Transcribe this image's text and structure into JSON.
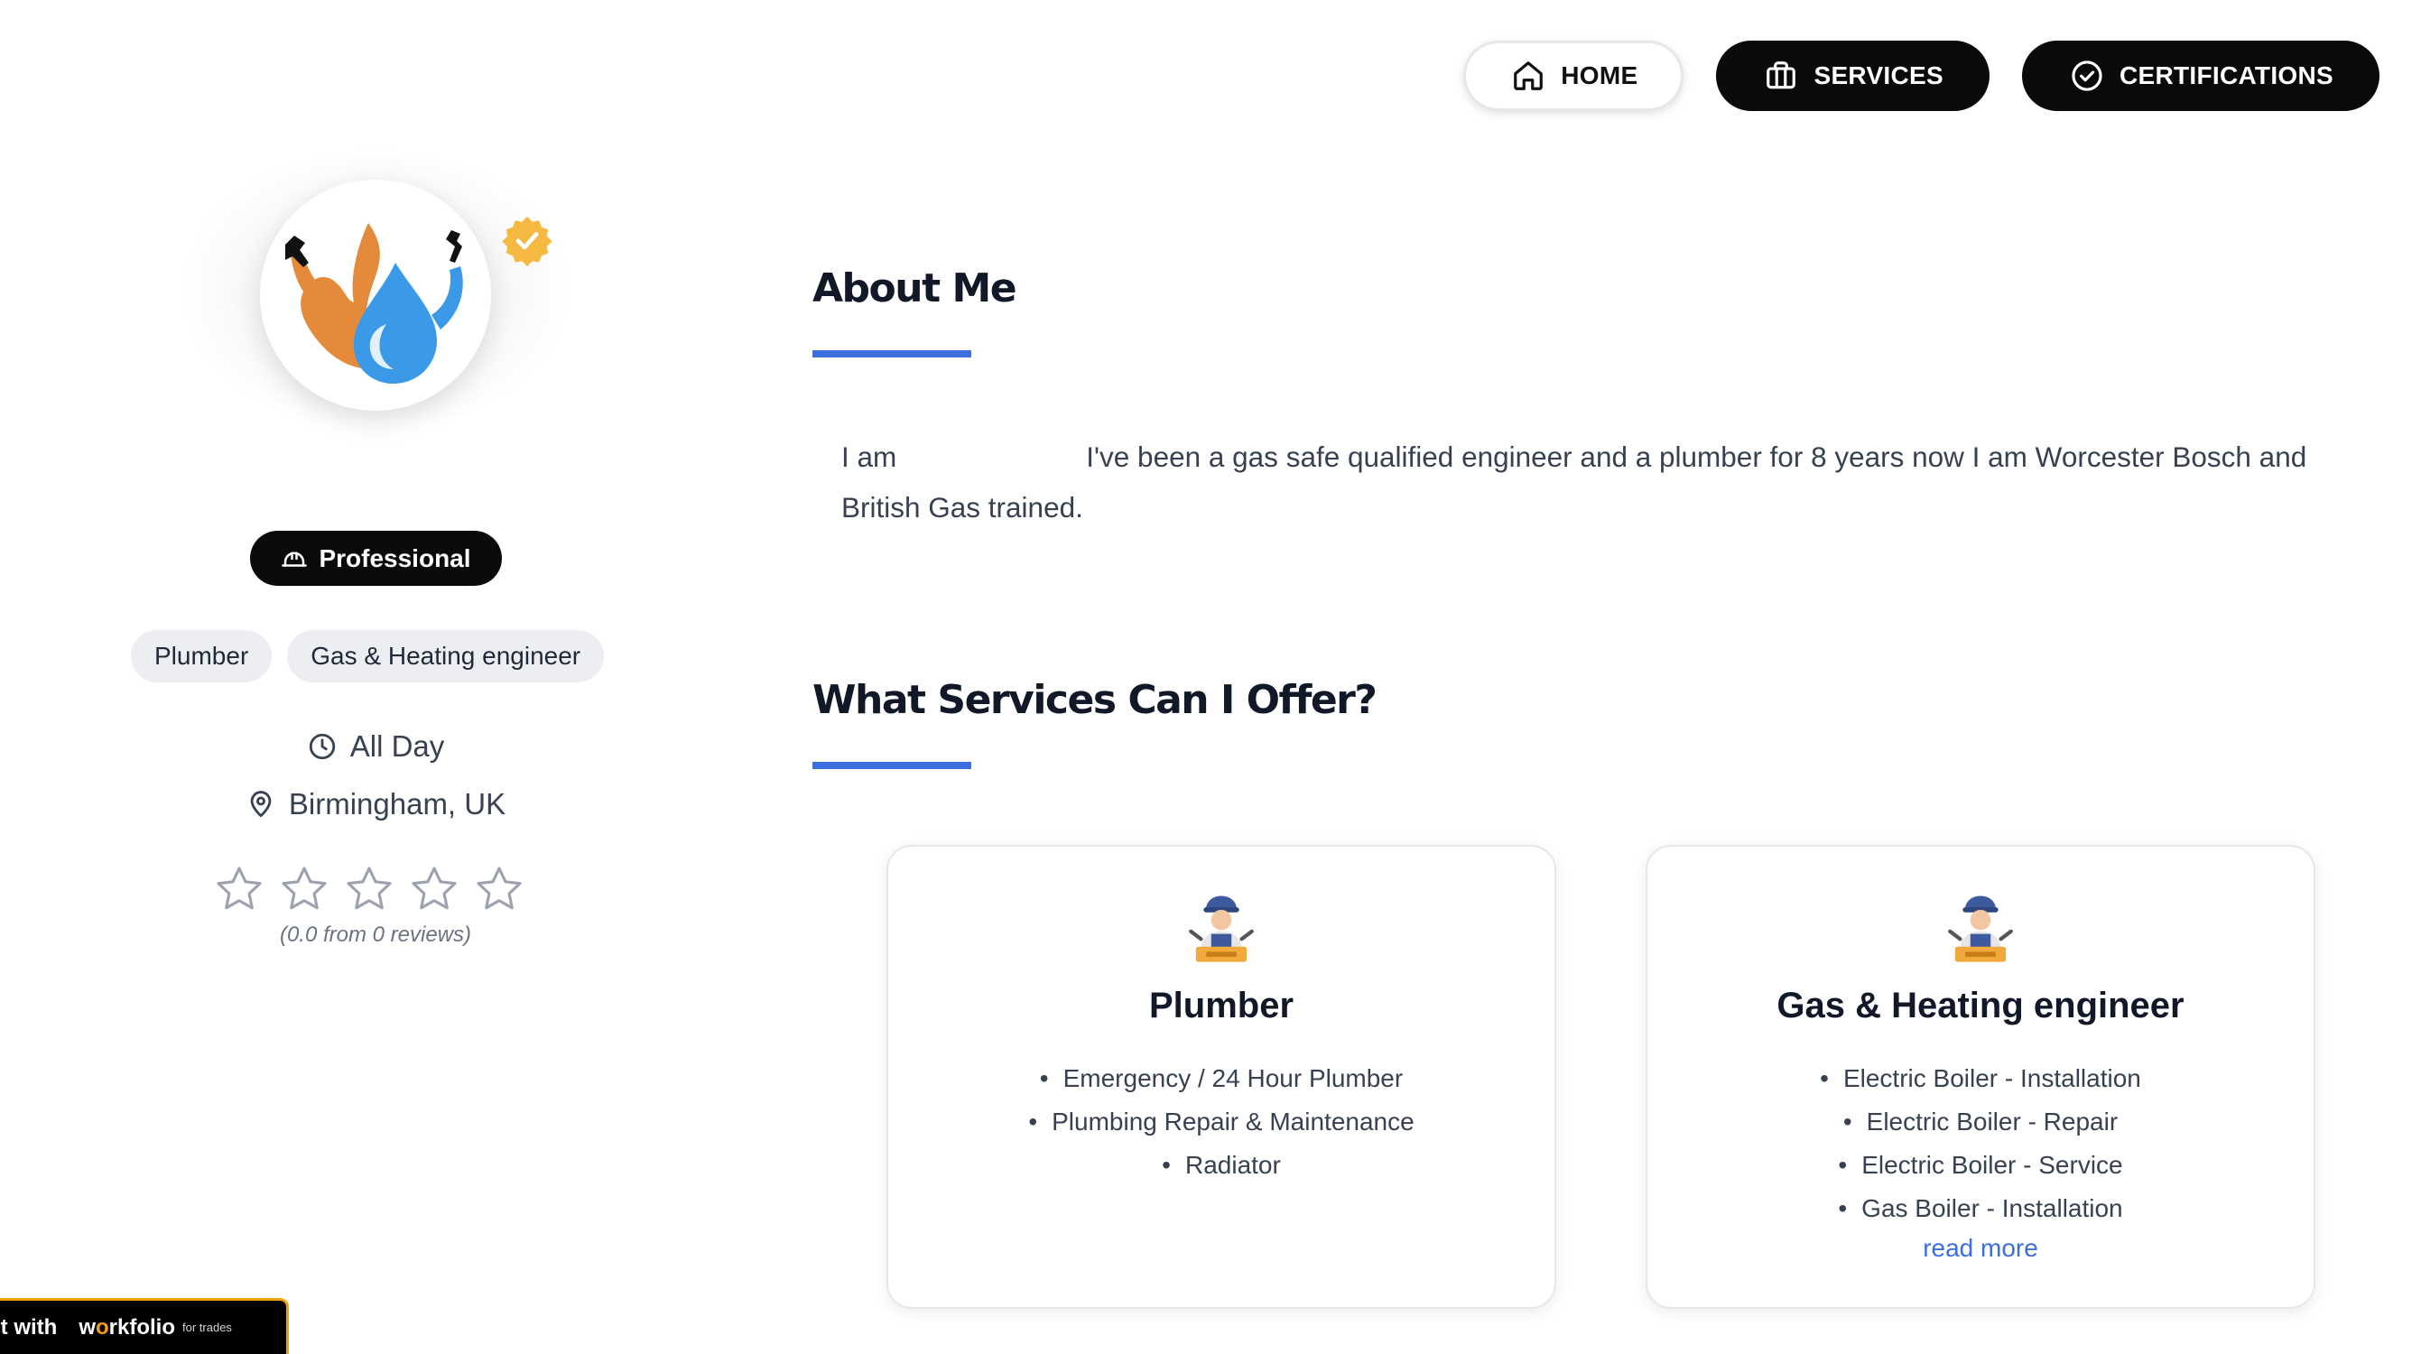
{
  "nav": {
    "home_label": "HOME",
    "services_label": "SERVICES",
    "certifications_label": "CERTIFICATIONS"
  },
  "profile": {
    "badge": "Professional",
    "tags": [
      "Plumber",
      "Gas & Heating engineer"
    ],
    "availability": "All Day",
    "location": "Birmingham, UK",
    "rating": 0,
    "rating_max": 5,
    "reviews_text": "(0.0 from 0 reviews)"
  },
  "about": {
    "title": "About Me",
    "text_prefix": "I am",
    "text_body": "I've been a gas safe qualified engineer and a plumber for 8 years now I am Worcester Bosch and British Gas trained."
  },
  "services": {
    "title": "What Services Can I Offer?",
    "cards": [
      {
        "title": "Plumber",
        "items": [
          "Emergency / 24 Hour Plumber",
          "Plumbing Repair & Maintenance",
          "Radiator"
        ]
      },
      {
        "title": "Gas & Heating engineer",
        "items": [
          "Electric Boiler - Installation",
          "Electric Boiler - Repair",
          "Electric Boiler - Service",
          "Gas Boiler - Installation"
        ],
        "read_more": "read more"
      }
    ]
  },
  "footer": {
    "built_prefix": "lt with",
    "brand_pre": "w",
    "brand_o": "o",
    "brand_post": "rkfolio",
    "brand_sub": "for trades"
  },
  "colors": {
    "accent": "#3b6fe0",
    "dark": "#0a0a0a",
    "tag_bg": "#eceef2",
    "badge_gold": "#f5b942"
  }
}
